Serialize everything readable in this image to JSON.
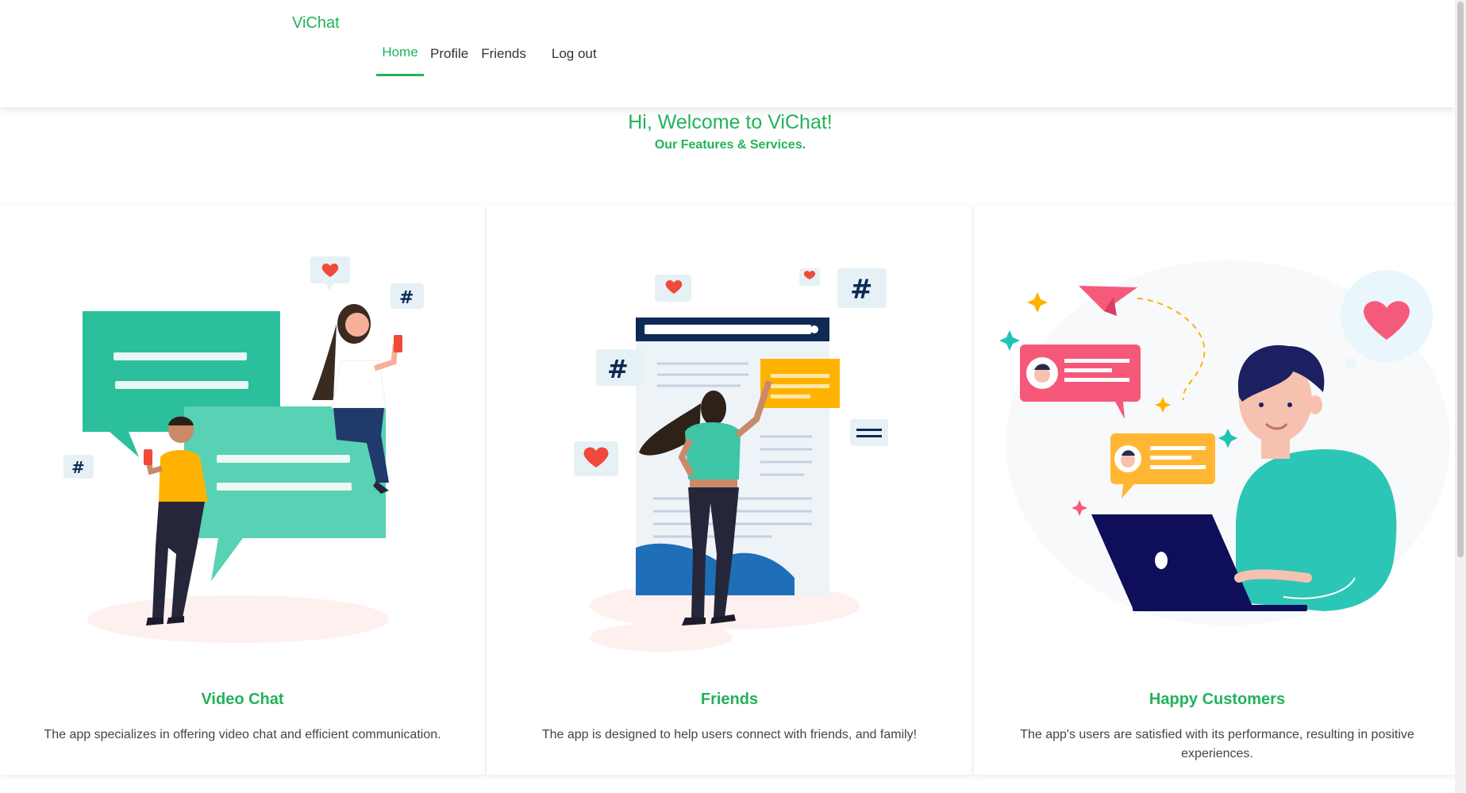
{
  "navbar": {
    "brand": "ViChat",
    "links": {
      "home": "Home",
      "profile": "Profile",
      "friends": "Friends",
      "logout": "Log out"
    },
    "active": "home"
  },
  "welcome": {
    "title": "Hi, Welcome to ViChat!",
    "subtitle": "Our Features & Services."
  },
  "cards": [
    {
      "title": "Video Chat",
      "text": "The app specializes in offering video chat and efficient communication.",
      "illustration": "video-chat-illustration"
    },
    {
      "title": "Friends",
      "text": "The app is designed to help users connect with friends, and family!",
      "illustration": "friends-illustration"
    },
    {
      "title": "Happy Customers",
      "text": "The app's users are satisfied with its performance, resulting in positive experiences.",
      "illustration": "happy-customers-illustration"
    }
  ],
  "colors": {
    "brand": "#21b35a",
    "teal": "#2fc3a6",
    "orange": "#ffb300",
    "red": "#f04a3a",
    "navy": "#0d2a55",
    "pink": "#f65a7a"
  }
}
